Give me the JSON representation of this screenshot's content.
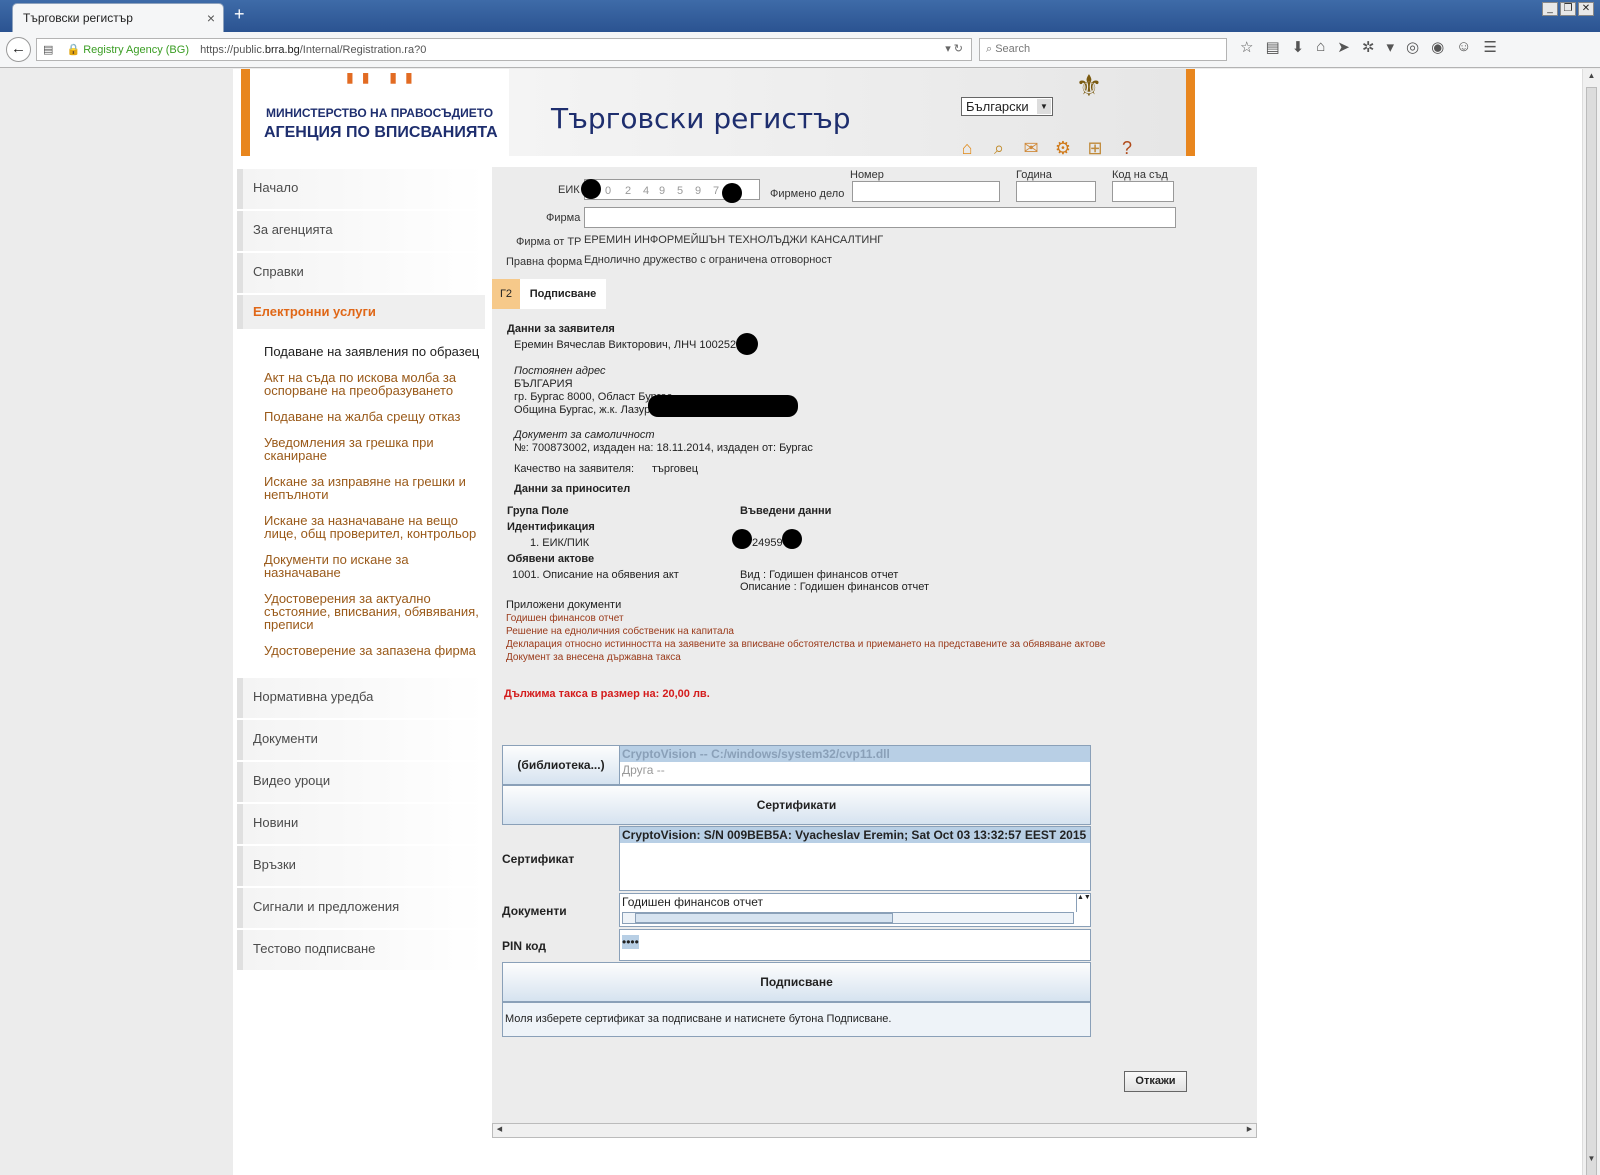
{
  "browser": {
    "tab_title": "Търговски регистър",
    "tab_close": "×",
    "new_tab": "+",
    "org_badge": "Registry Agency (BG)",
    "url_prefix": "https://public.",
    "url_host": "brra.bg",
    "url_path": "/Internal/Registration.ra?0",
    "search_placeholder": "Search",
    "icons": [
      "back-icon",
      "reader-icon",
      "lock-icon",
      "reload-icon",
      "star-icon",
      "bookmarks-icon",
      "download-icon",
      "home-icon",
      "send-icon",
      "extension-icon",
      "menu-icon"
    ]
  },
  "header": {
    "ministry": "МИНИСТЕРСТВО НА ПРАВОСЪДИЕТО",
    "agency": "АГЕНЦИЯ ПО ВПИСВАНИЯТА",
    "site_title": "Търговски регистър",
    "language": "Български",
    "icons": [
      "home-icon",
      "search-icon",
      "mail-icon",
      "settings-icon",
      "sitemap-icon",
      "help-icon"
    ]
  },
  "nav": {
    "home": "Начало",
    "agency": "За агенцията",
    "reports": "Справки",
    "e_services": "Електронни услуги",
    "sub": [
      "Подаване на заявления по образец",
      "Акт на съда по искова молба за оспорване на преобразуването",
      "Подаване на жалба срещу отказ",
      "Уведомления за грешка при сканиране",
      "Искане за изправяне на грешки и непълноти",
      "Искане за назначаване на вещо лице, общ проверител, контрольор",
      "Документи по искане за назначаване",
      "Удостоверения за актуално състояние, вписвания, обявявания, преписи",
      "Удостоверение за запазена фирма"
    ],
    "bottom": [
      "Нормативна уредба",
      "Документи",
      "Видео уроци",
      "Новини",
      "Връзки",
      "Сигнали и предложения",
      "Тестово подписване"
    ]
  },
  "company": {
    "eik_label": "ЕИК",
    "eik_digits": [
      "0",
      "2",
      "4",
      "9",
      "5",
      "9",
      "7"
    ],
    "firm_case_label": "Фирмено дело",
    "number_label": "Номер",
    "year_label": "Година",
    "court_code_label": "Код на съд",
    "firm_label": "Фирма",
    "firm_tr_label": "Фирма от ТР",
    "firm_tr_value": "ЕРЕМИН ИНФОРМЕЙШЪН ТЕХНОЛЪДЖИ КАНСАЛТИНГ",
    "legal_form_label": "Правна форма",
    "legal_form_value": "Еднолично дружество с ограничена отговорност"
  },
  "tabs": {
    "form_code": "Г2",
    "signing": "Подписване"
  },
  "applicant": {
    "heading": "Данни за заявителя",
    "name": "Еремин Вячеслав Викторович, ЛНЧ 1002525",
    "address_heading": "Постоянен адрес",
    "country": "БЪЛГАРИЯ",
    "city": "гр. Бургас 8000, Област Бургас",
    "municipality": "Община Бургас, ж.к. Лазур",
    "id_heading": "Документ за самоличност",
    "id_value": "№: 700873002, издаден на: 18.11.2014, издаден от: Бургас",
    "quality_label": "Качество на заявителя:",
    "quality_value": "търговец",
    "bearer_heading": "Данни за приносител"
  },
  "fields": {
    "group_header": "Група Поле",
    "entered_header": "Въведени данни",
    "identification": "Идентификация",
    "eik_item": "1. ЕИК/ПИК",
    "eik_value": "24959",
    "acts_heading": "Обявени актове",
    "act_item": "1001. Описание на обявения акт",
    "act_type": "Вид : Годишен финансов отчет",
    "act_desc": "Описание : Годишен финансов отчет"
  },
  "attachments": {
    "heading": "Приложени документи",
    "items": [
      "Годишен финансов отчет",
      "Решение на едноличния собственик на капитала",
      "Декларация относно истинността на заявените за вписване обстоятелства и приемането на представените за обявяване актове",
      "Документ за внесена държавна такса"
    ]
  },
  "fee": "Дължима такса в размер на: 20,00 лв.",
  "signer": {
    "library_button": "(библиотека...)",
    "libraries": [
      "CryptoVision -- C:/windows/system32/cvp11.dll",
      "Друга --"
    ],
    "certificates_button": "Сертификати",
    "certificate_label": "Сертификат",
    "certificate_selected": "CryptoVision: S/N 009BEB5A: Vyacheslav Eremin; Sat Oct 03 13:32:57 EEST 2015",
    "documents_label": "Документи",
    "document_item": "Годишен финансов отчет",
    "pin_label": "PIN код",
    "pin_value": "••••",
    "sign_button": "Подписване",
    "status": "Моля изберете сертификат за подписване и натиснете бутона Подписване."
  },
  "cancel_button": "Откажи"
}
